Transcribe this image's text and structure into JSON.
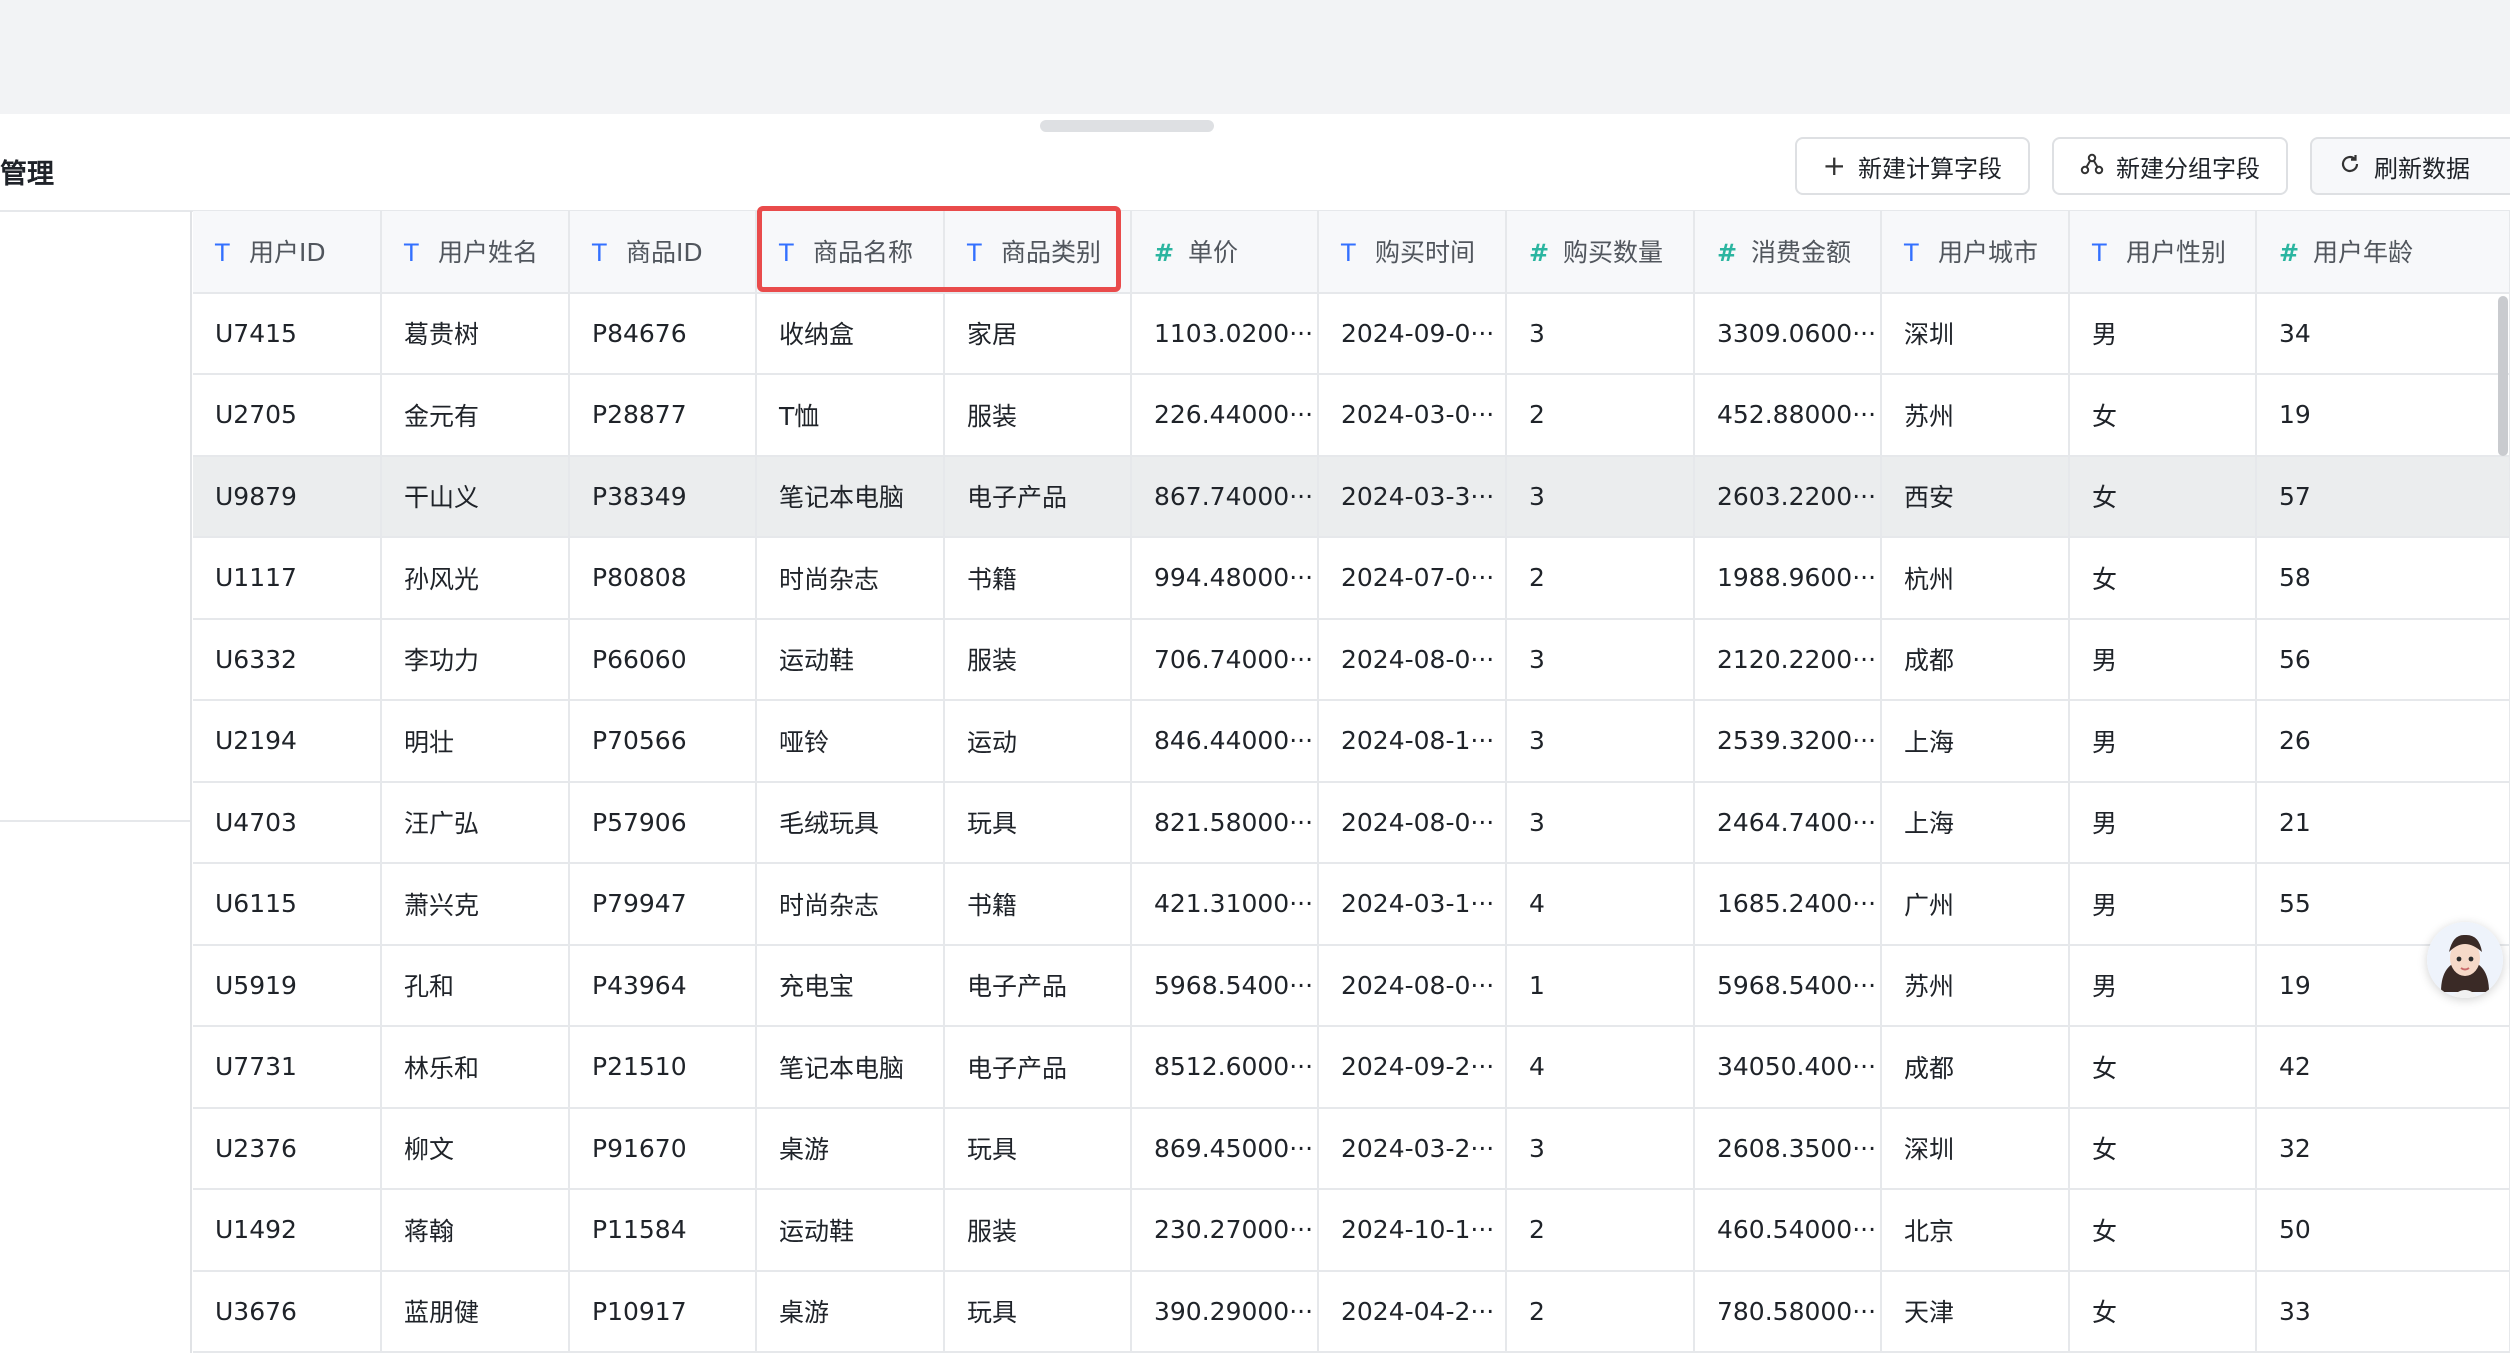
{
  "page": {
    "title": "管理"
  },
  "toolbar": {
    "calc_label": "新建计算字段",
    "group_label": "新建分组字段",
    "refresh_label": "刷新数据"
  },
  "table": {
    "columns": [
      {
        "type": "T",
        "label": "用户ID"
      },
      {
        "type": "T",
        "label": "用户姓名"
      },
      {
        "type": "T",
        "label": "商品ID"
      },
      {
        "type": "T",
        "label": "商品名称"
      },
      {
        "type": "T",
        "label": "商品类别"
      },
      {
        "type": "#",
        "label": "单价"
      },
      {
        "type": "T",
        "label": "购买时间"
      },
      {
        "type": "#",
        "label": "购买数量"
      },
      {
        "type": "#",
        "label": "消费金额"
      },
      {
        "type": "T",
        "label": "用户城市"
      },
      {
        "type": "T",
        "label": "用户性别"
      },
      {
        "type": "#",
        "label": "用户年龄"
      }
    ],
    "rows": [
      [
        "U7415",
        "葛贵树",
        "P84676",
        "收纳盒",
        "家居",
        "1103.0200···",
        "2024-09-0···",
        "3",
        "3309.0600···",
        "深圳",
        "男",
        "34"
      ],
      [
        "U2705",
        "金元有",
        "P28877",
        "T恤",
        "服装",
        "226.44000···",
        "2024-03-0···",
        "2",
        "452.88000···",
        "苏州",
        "女",
        "19"
      ],
      [
        "U9879",
        "干山义",
        "P38349",
        "笔记本电脑",
        "电子产品",
        "867.74000···",
        "2024-03-3···",
        "3",
        "2603.2200···",
        "西安",
        "女",
        "57"
      ],
      [
        "U1117",
        "孙风光",
        "P80808",
        "时尚杂志",
        "书籍",
        "994.48000···",
        "2024-07-0···",
        "2",
        "1988.9600···",
        "杭州",
        "女",
        "58"
      ],
      [
        "U6332",
        "李功力",
        "P66060",
        "运动鞋",
        "服装",
        "706.74000···",
        "2024-08-0···",
        "3",
        "2120.2200···",
        "成都",
        "男",
        "56"
      ],
      [
        "U2194",
        "明壮",
        "P70566",
        "哑铃",
        "运动",
        "846.44000···",
        "2024-08-1···",
        "3",
        "2539.3200···",
        "上海",
        "男",
        "26"
      ],
      [
        "U4703",
        "汪广弘",
        "P57906",
        "毛绒玩具",
        "玩具",
        "821.58000···",
        "2024-08-0···",
        "3",
        "2464.7400···",
        "上海",
        "男",
        "21"
      ],
      [
        "U6115",
        "萧兴克",
        "P79947",
        "时尚杂志",
        "书籍",
        "421.31000···",
        "2024-03-1···",
        "4",
        "1685.2400···",
        "广州",
        "男",
        "55"
      ],
      [
        "U5919",
        "孔和",
        "P43964",
        "充电宝",
        "电子产品",
        "5968.5400···",
        "2024-08-0···",
        "1",
        "5968.5400···",
        "苏州",
        "男",
        "19"
      ],
      [
        "U7731",
        "林乐和",
        "P21510",
        "笔记本电脑",
        "电子产品",
        "8512.6000···",
        "2024-09-2···",
        "4",
        "34050.400···",
        "成都",
        "女",
        "42"
      ],
      [
        "U2376",
        "柳文",
        "P91670",
        "桌游",
        "玩具",
        "869.45000···",
        "2024-03-2···",
        "3",
        "2608.3500···",
        "深圳",
        "女",
        "32"
      ],
      [
        "U1492",
        "蒋翰",
        "P11584",
        "运动鞋",
        "服装",
        "230.27000···",
        "2024-10-1···",
        "2",
        "460.54000···",
        "北京",
        "女",
        "50"
      ],
      [
        "U3676",
        "蓝朋健",
        "P10917",
        "桌游",
        "玩具",
        "390.29000···",
        "2024-04-2···",
        "2",
        "780.58000···",
        "天津",
        "女",
        "33"
      ]
    ],
    "highlighted_row": 2
  },
  "icons": {
    "calc": "plus-icon",
    "group": "group-icon",
    "refresh": "refresh-icon",
    "assistant": "assistant-avatar-icon"
  },
  "colors": {
    "text_type": "#3370ff",
    "number_type": "#2bb5a0",
    "highlight_box": "#e94b4b",
    "row_highlight": "#ebedee"
  }
}
